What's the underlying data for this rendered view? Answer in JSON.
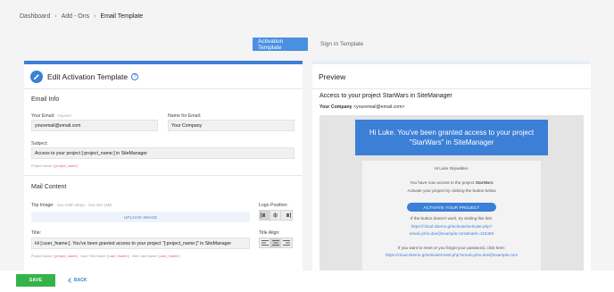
{
  "breadcrumb": {
    "items": [
      "Dashboard",
      "Add - Ons",
      "Email Template"
    ],
    "separator": "›"
  },
  "tabs": [
    {
      "label": "Activation Template",
      "active": true
    },
    {
      "label": "Sign In Template",
      "active": false
    }
  ],
  "editor": {
    "title": "Edit Activation Template",
    "help_glyph": "?",
    "email_info": {
      "section_title": "Email Info",
      "your_email_label": "Your Email:",
      "your_email_hint": "required",
      "your_email_value": "youremail@email.com",
      "name_for_email_label": "Name for Email:",
      "name_for_email_value": "Your Company",
      "subject_label": "Subject:",
      "subject_value": "Access to your project [:project_name:] in SiteManager",
      "subject_meta_label": "Project Name:",
      "subject_meta_token": "[:project_name:]"
    },
    "mail_content": {
      "section_title": "Mail Content",
      "top_image_label": "Top Image:",
      "top_image_hint": "max width 450px - max size 1MB",
      "upload_label": "UPLOAD IMAGE",
      "logo_position_label": "Logo Position:",
      "title_label": "Title:",
      "title_value": "Hi [:user_fname:].  You've been granted access to your project \"[:project_name:]\" in SiteManager",
      "title_align_label": "Title Align:",
      "title_meta": [
        {
          "label": "Project Name:",
          "token": "[:project_name:]"
        },
        {
          "label": "User First Name:",
          "token": "[:user_fname:]"
        },
        {
          "label": "User Last Name:",
          "token": "[:user_lname:]"
        }
      ]
    }
  },
  "preview": {
    "title": "Preview",
    "subject": "Access to your project StarWars in SiteManager",
    "from_name": "Your Company",
    "from_email": "<youremail@email.com>",
    "banner": "Hi Luke.  You've been granted access to your project \"StarWars\" in SiteManager",
    "greeting": "Hi Luke Skywalker.",
    "body_line1_prefix": "You have now access to the project ",
    "body_line1_project": "StarWars",
    "body_line2": "Activate your project by clicking the button below",
    "activate_button": "ACTIVATE YOUR PROJECT",
    "fallback_text": "If the button doesn't work, try visiting this link:",
    "activate_link_1": "https://cloud.sitemn.gr/activate/activate.php?",
    "activate_link_2": "email=john.doe@example.com&hash=123456",
    "reset_text": "If you want to reset or you forgot your password, click here:",
    "reset_link": "https://cloud.sitemn.gr/activate/reset.php?email=john.doe@example.com"
  },
  "footer": {
    "save_label": "SAVE",
    "back_label": "BACK"
  },
  "colors": {
    "accent": "#3b7fd6",
    "save": "#35b34a",
    "token": "#e05a6a"
  }
}
